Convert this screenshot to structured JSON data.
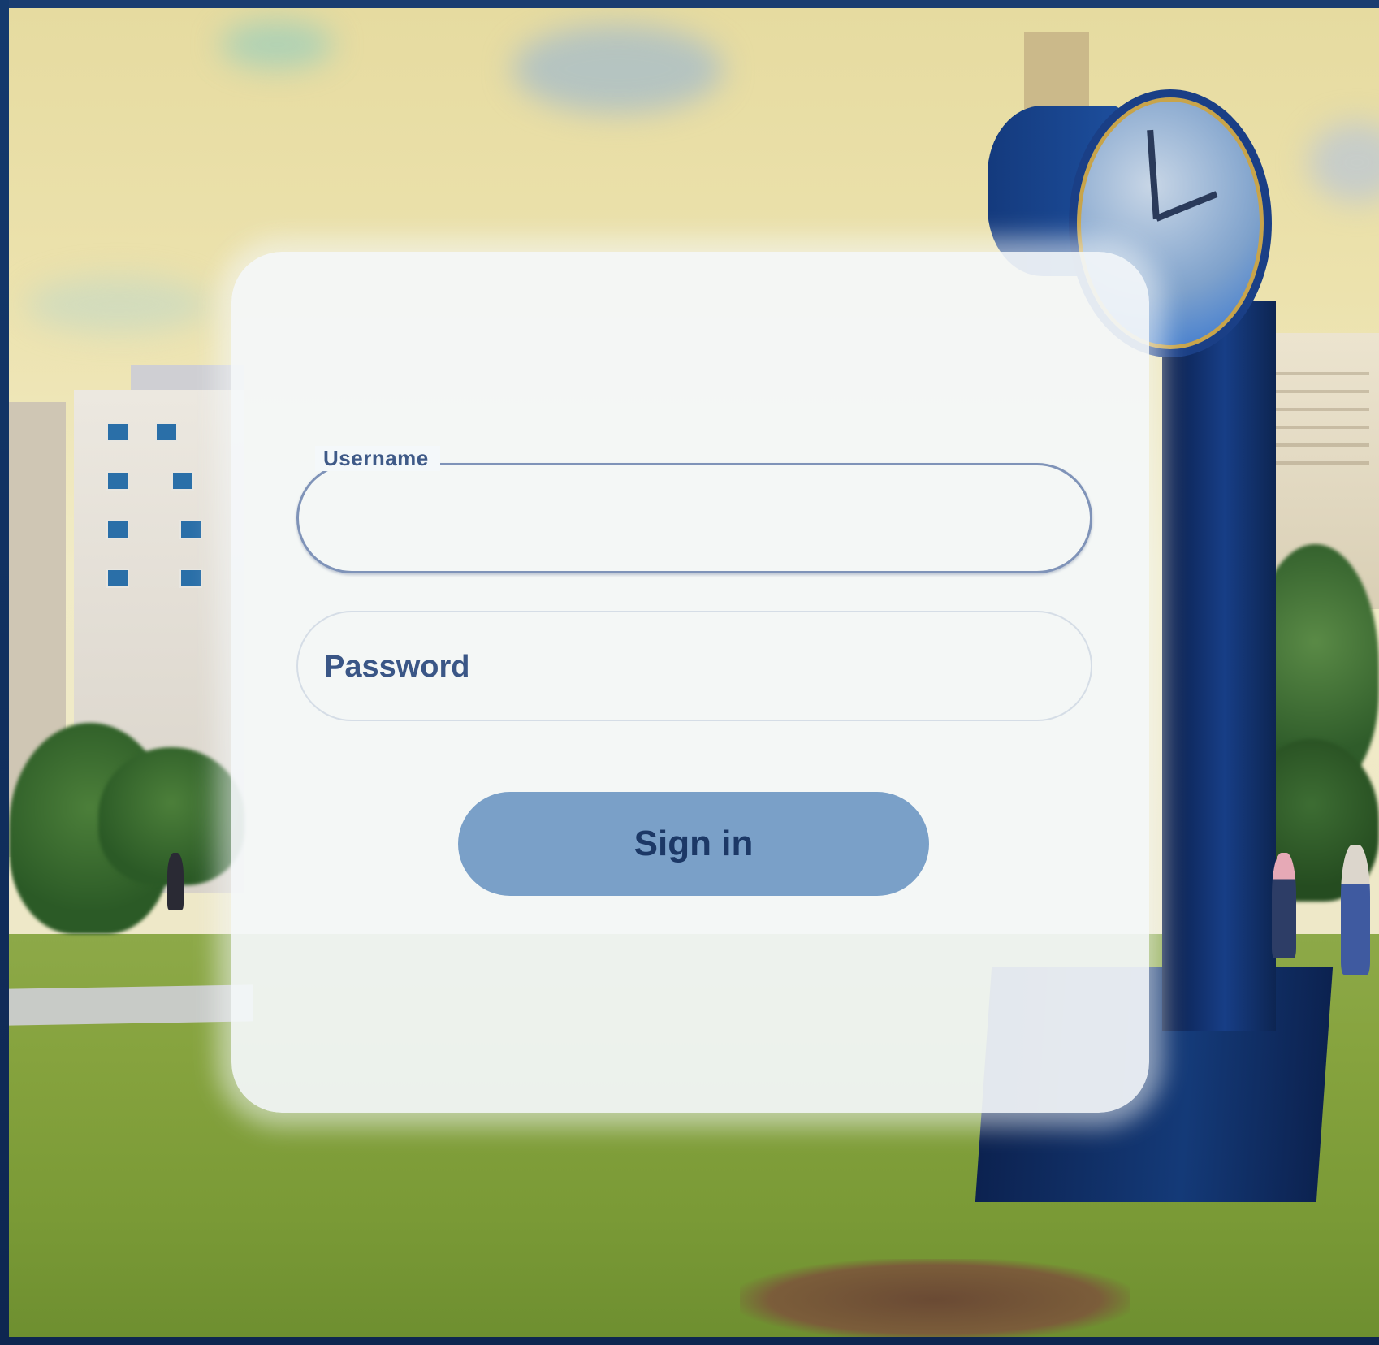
{
  "login": {
    "username_label": "Username",
    "username_value": "",
    "password_placeholder": "Password",
    "password_value": "",
    "signin_label": "Sign in"
  },
  "colors": {
    "frame": "#12305e",
    "card": "#f4f8fa",
    "field_border": "#7f93b8",
    "label_text": "#3f5a88",
    "button_bg": "#7aa0c8",
    "button_text": "#1c3866"
  }
}
